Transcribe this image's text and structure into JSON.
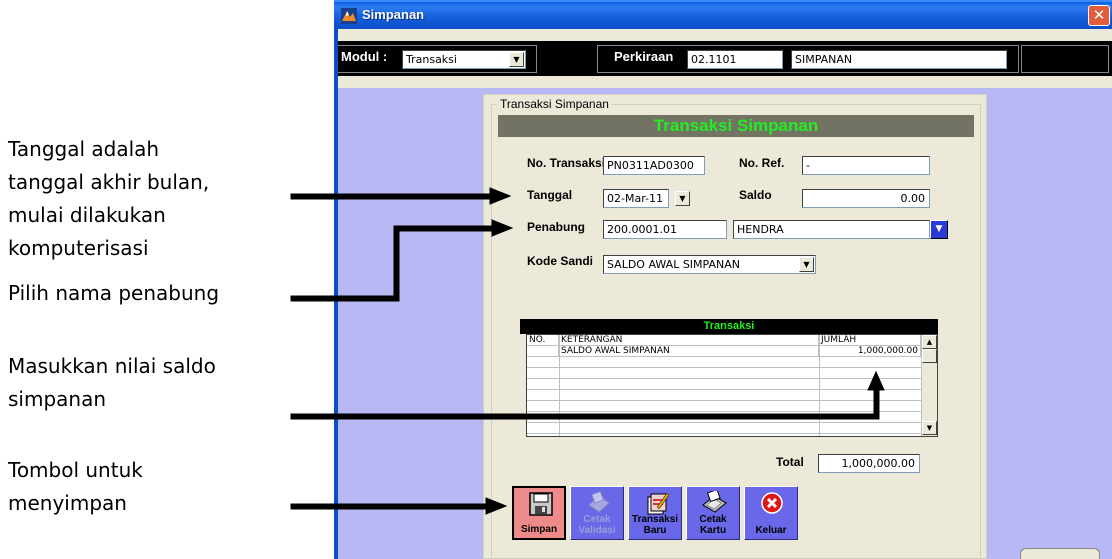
{
  "annotations": [
    {
      "text": "Tanggal adalah\ntanggal akhir bulan,\nmulai dilakukan\nkomputerisasi"
    },
    {
      "text": "Pilih nama penabung"
    },
    {
      "text": "Masukkan nilai saldo\nsimpanan"
    },
    {
      "text": "Tombol untuk\nmenyimpan"
    }
  ],
  "window": {
    "title": "Simpanan",
    "close_glyph": "✕"
  },
  "toolbar": {
    "modul_label": "Modul :",
    "modul_value": "Transaksi",
    "perkiraan_label": "Perkiraan",
    "perkiraan_code": "02.1101",
    "perkiraan_name": "SIMPANAN"
  },
  "form": {
    "group_title": "Transaksi Simpanan",
    "heading": "Transaksi Simpanan",
    "no_transaksi_label": "No. Transaksi",
    "no_transaksi_value": "PN0311AD0300",
    "no_ref_label": "No. Ref.",
    "no_ref_value": "-",
    "tanggal_label": "Tanggal",
    "tanggal_value": "02-Mar-11",
    "saldo_label": "Saldo",
    "saldo_value": "0.00",
    "penabung_label": "Penabung",
    "penabung_code": "200.0001.01",
    "penabung_name": "HENDRA",
    "kode_sandi_label": "Kode Sandi",
    "kode_sandi_value": "SALDO AWAL SIMPANAN"
  },
  "grid": {
    "title": "Transaksi",
    "columns": [
      "NO.",
      "KETERANGAN",
      "JUMLAH"
    ],
    "rows": [
      {
        "no": "",
        "keterangan": "SALDO AWAL SIMPANAN",
        "jumlah": "1,000,000.00"
      }
    ]
  },
  "total": {
    "label": "Total",
    "value": "1,000,000.00"
  },
  "buttons": [
    {
      "label": "Simpan",
      "enabled": true,
      "icon": "floppy-disk-icon"
    },
    {
      "label": "Cetak\nValidasi",
      "enabled": false,
      "icon": "print-icon"
    },
    {
      "label": "Transaksi\nBaru",
      "enabled": true,
      "icon": "new-document-icon"
    },
    {
      "label": "Cetak\nKartu",
      "enabled": true,
      "icon": "print-card-icon"
    },
    {
      "label": "Keluar",
      "enabled": true,
      "icon": "close-circle-icon"
    }
  ],
  "colors": {
    "heading_text": "#22ee22",
    "button_bg": "#6868e8",
    "window_bg": "#b8b8f4"
  }
}
